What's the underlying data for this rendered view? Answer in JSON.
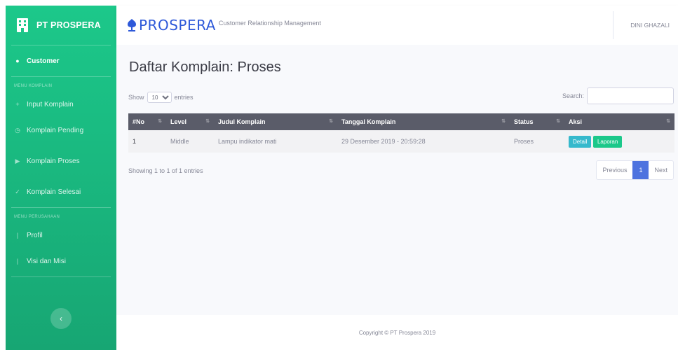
{
  "sidebar": {
    "brand": "PT PROSPERA",
    "active_item": "Customer",
    "heading_complaint": "MENU KOMPLAIN",
    "heading_company": "MENU PERUSAHAAN",
    "items": [
      {
        "label": "Input Komplain",
        "icon": "plus-icon"
      },
      {
        "label": "Komplain Pending",
        "icon": "clock-icon"
      },
      {
        "label": "Komplain Proses",
        "icon": "play-icon"
      },
      {
        "label": "Komplain Selesai",
        "icon": "check-icon"
      }
    ],
    "company_items": [
      {
        "label": "Profil",
        "icon": "info-icon"
      },
      {
        "label": "Visi dan Misi",
        "icon": "info-icon"
      }
    ],
    "toggle_icon": "chevron-left-icon",
    "color": "#1cc88a"
  },
  "topbar": {
    "logo_text": "PROSPERA",
    "subtitle": "Customer Relationship Management",
    "user_name": "DINI GHAZALI"
  },
  "main": {
    "title": "Daftar Komplain: Proses",
    "length_prefix": "Show",
    "length_value": "10",
    "length_suffix": "entries",
    "search_label": "Search:",
    "table": {
      "headers": [
        "#No",
        "Level",
        "Judul Komplain",
        "Tanggal Komplain",
        "Status",
        "Aksi"
      ],
      "rows": [
        {
          "no": "1",
          "level": "Middle",
          "judul": "Lampu indikator mati",
          "tanggal": "29 Desember 2019 - 20:59:28",
          "status": "Proses",
          "actions": [
            "Detail",
            "Laporan"
          ]
        }
      ]
    },
    "info_text": "Showing 1 to 1 of 1 entries",
    "pagination": {
      "previous": "Previous",
      "current": "1",
      "next": "Next"
    }
  },
  "footer": {
    "text": "Copyright © PT Prospera 2019"
  },
  "colors": {
    "primary": "#4e73df",
    "success": "#1cc88a",
    "info": "#36b9cc",
    "header_dark": "#5a5c69"
  }
}
